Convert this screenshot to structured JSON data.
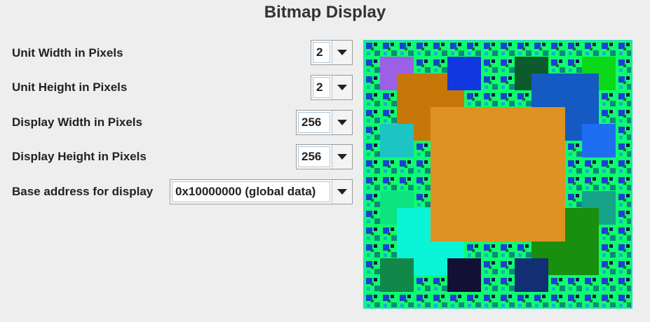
{
  "title": "Bitmap Display",
  "settings": {
    "unit_width": {
      "label": "Unit Width in Pixels",
      "value": "2"
    },
    "unit_height": {
      "label": "Unit Height in Pixels",
      "value": "2"
    },
    "display_width": {
      "label": "Display Width in Pixels",
      "value": "256"
    },
    "display_height": {
      "label": "Display Height in Pixels",
      "value": "256"
    },
    "base_address": {
      "label": "Base address for display",
      "value": "0x10000000 (global data)"
    }
  },
  "icons": {
    "dropdown_arrow": "chevron-down-icon"
  },
  "bitmap": {
    "background_color": "#0dfd6e",
    "border_color": "#1de3b0",
    "squares": [
      {
        "color": "#9d5ee8"
      },
      {
        "color": "#c77708"
      },
      {
        "color": "#1138e0"
      },
      {
        "color": "#0d5a2c"
      },
      {
        "color": "#0cd81a"
      },
      {
        "color": "#155ac2"
      },
      {
        "color": "#1d6ef0"
      },
      {
        "color": "#1cc4c4"
      },
      {
        "color": "#0de37f"
      },
      {
        "color": "#15a38a"
      },
      {
        "color": "#0af4d8"
      },
      {
        "color": "#131036"
      },
      {
        "color": "#188f0f"
      },
      {
        "color": "#122f73"
      },
      {
        "color": "#11874a"
      },
      {
        "color": "#df9221"
      }
    ]
  }
}
